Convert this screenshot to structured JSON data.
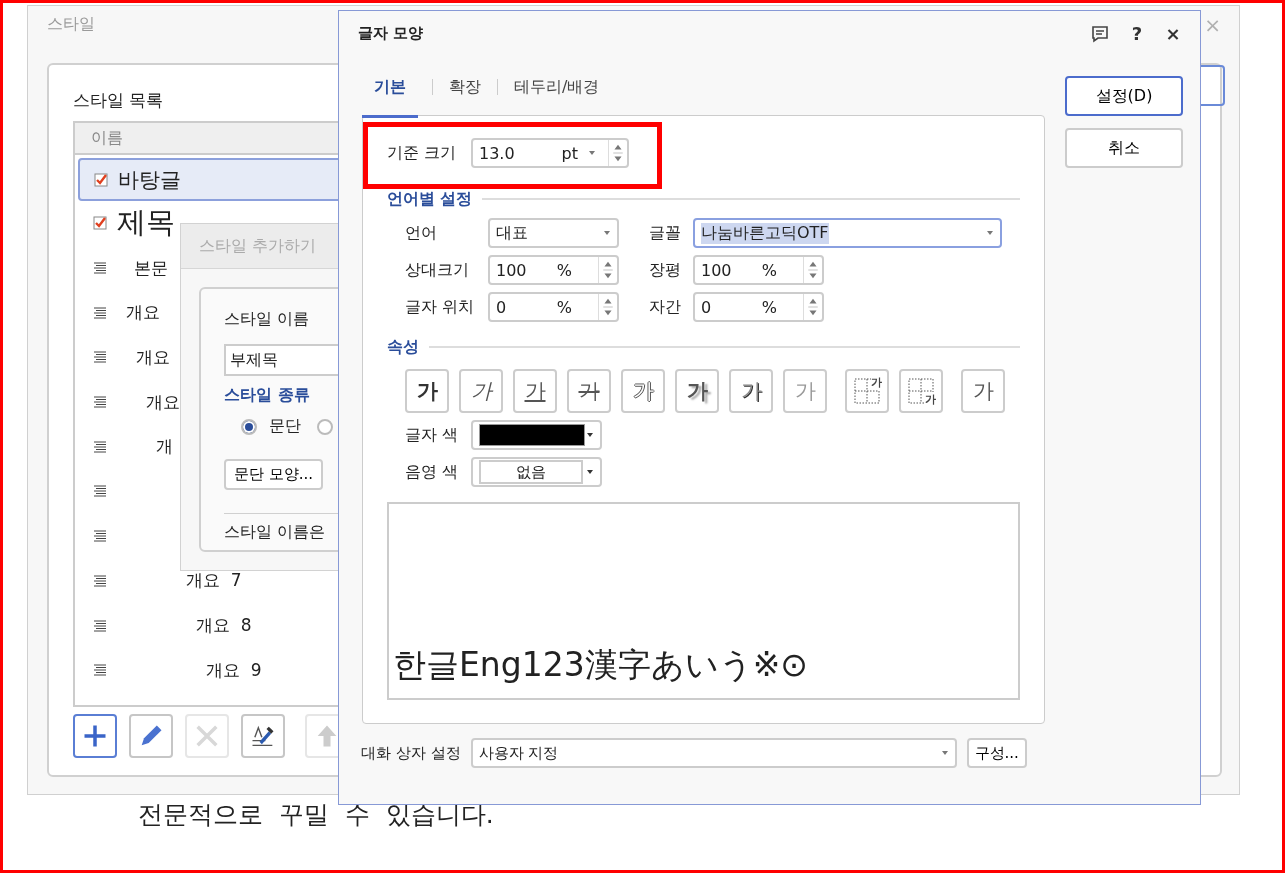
{
  "style_window": {
    "title": "스타일",
    "close": "×",
    "list_label": "스타일 목록",
    "column": "이름",
    "rows": [
      {
        "kind": "plain",
        "name": "바탕글",
        "selected": true
      },
      {
        "kind": "heading",
        "name": "제목",
        "selected": false
      },
      {
        "kind": "outline",
        "name": "본문",
        "selected": false
      },
      {
        "kind": "outline",
        "name": "개요",
        "selected": false
      },
      {
        "kind": "outline",
        "name": "개요",
        "selected": false
      },
      {
        "kind": "outline",
        "name": "개요",
        "selected": false
      },
      {
        "kind": "outline",
        "name": "개",
        "selected": false
      },
      {
        "kind": "outline",
        "selected": false
      },
      {
        "kind": "outline",
        "selected": false
      },
      {
        "kind": "outline",
        "name": "개요  7",
        "selected": false
      },
      {
        "kind": "outline",
        "name": "개요  8",
        "selected": false
      },
      {
        "kind": "outline",
        "name": "개요  9",
        "selected": false
      }
    ],
    "toolbar": [
      {
        "kind": "add",
        "disabled": false,
        "focused": true
      },
      {
        "kind": "edit",
        "disabled": false,
        "focused": false
      },
      {
        "kind": "delete",
        "disabled": true,
        "focused": false
      },
      {
        "kind": "picker",
        "disabled": false,
        "focused": false
      },
      {
        "kind": "up",
        "disabled": true,
        "focused": false
      }
    ]
  },
  "document_text": "전문적으로  꾸밀  수  있습니다.",
  "add_style_dialog": {
    "title": "스타일 추가하기",
    "name_label": "스타일 이름",
    "name_value": "부제목",
    "type_heading": "스타일 종류",
    "type_options": [
      {
        "label": "문단",
        "selected": true
      },
      {
        "selected": false
      }
    ],
    "paragraph_button": "문단 모양...",
    "note": "스타일 이름은"
  },
  "char_dialog": {
    "title": "글자 모양",
    "help": "?",
    "close": "×",
    "tabs": [
      {
        "label": "기본",
        "selected": true
      },
      {
        "label": "확장",
        "selected": false
      },
      {
        "label": "테두리/배경",
        "selected": false
      }
    ],
    "ok": "설정(D)",
    "cancel": "취소",
    "base_size": {
      "label": "기준 크기",
      "value": "13.0",
      "unit": "pt"
    },
    "lang_heading": "언어별 설정",
    "field_rows": [
      [
        {
          "label": "언어",
          "kind": "select",
          "value": "대표",
          "highlighted": false
        },
        {
          "label": "글꼴",
          "kind": "font",
          "value": "나눔바른고딕OTF",
          "highlighted": true
        }
      ],
      [
        {
          "label": "상대크기",
          "kind": "spinner",
          "value": "100",
          "unit": "%"
        },
        {
          "label": "장평",
          "kind": "spinner",
          "value": "100",
          "unit": "%"
        }
      ],
      [
        {
          "label": "글자 위치",
          "kind": "spinner",
          "value": "0",
          "unit": "%"
        },
        {
          "label": "자간",
          "kind": "spinner",
          "value": "0",
          "unit": "%"
        }
      ]
    ],
    "attr_heading": "속성",
    "attributes": [
      {
        "kind": "bold",
        "text": "가"
      },
      {
        "kind": "italic",
        "text": "가"
      },
      {
        "kind": "underline",
        "text": "가"
      },
      {
        "kind": "strike",
        "text": "가"
      },
      {
        "kind": "outline",
        "text": "가"
      },
      {
        "kind": "shadow",
        "text": "가"
      },
      {
        "kind": "emboss",
        "text": "가"
      },
      {
        "kind": "engrave",
        "text": "가"
      },
      {
        "kind": "superscript",
        "text": "가"
      },
      {
        "kind": "subscript",
        "text": "가"
      },
      {
        "kind": "plain",
        "text": "가"
      }
    ],
    "text_color": {
      "label": "글자 색",
      "color": "#000000"
    },
    "shade_color": {
      "label": "음영 색",
      "value": "없음"
    },
    "preview": "한글Eng123漢字あいう※⊙",
    "footer": {
      "label": "대화 상자 설정",
      "value": "사용자 지정",
      "button": "구성..."
    }
  }
}
